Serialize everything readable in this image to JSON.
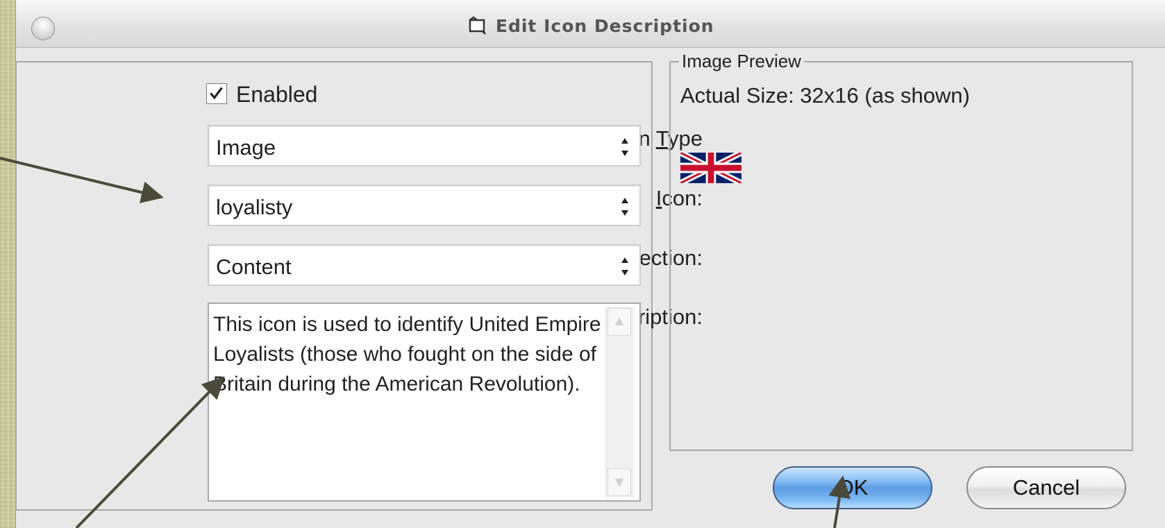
{
  "window": {
    "title": "Edit Icon Description"
  },
  "form": {
    "enabled": {
      "label": "Enabled",
      "checked": true
    },
    "icon_type": {
      "label_pre": "Icon ",
      "label_key": "T",
      "label_post": "ype",
      "value": "Image"
    },
    "icon": {
      "label_key": "I",
      "label_post": "con:",
      "value": "loyalisty"
    },
    "page_section": {
      "label": "Page Section:",
      "value": "Content"
    },
    "description": {
      "label_key": "D",
      "label_post": "escription:",
      "value": "This icon is used to identify United Empire Loyalists (those who fought on the side of Britain during the American Revolution)."
    }
  },
  "preview": {
    "legend": "Image Preview",
    "actual_size": "Actual Size: 32x16 (as shown)",
    "image_icon": "union-jack-flag"
  },
  "buttons": {
    "ok": "OK",
    "cancel": "Cancel"
  },
  "colors": {
    "ok_button": "#6aa8ec",
    "annotation_arrow": "#4a4a3a"
  }
}
